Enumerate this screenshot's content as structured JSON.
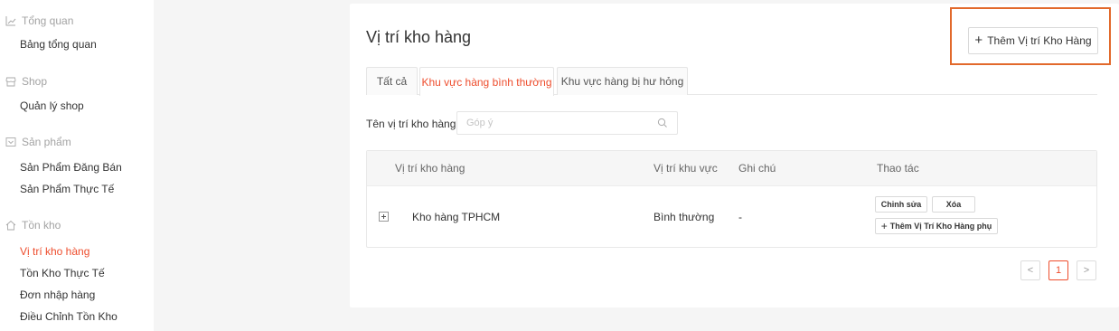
{
  "sidebar": {
    "groups": [
      {
        "label": "Tổng quan",
        "icon": "chart-line-icon",
        "items": [
          {
            "label": "Bảng tổng quan"
          }
        ]
      },
      {
        "label": "Shop",
        "icon": "shop-icon",
        "items": [
          {
            "label": "Quản lý shop"
          }
        ]
      },
      {
        "label": "Sản phẩm",
        "icon": "product-box-icon",
        "items": [
          {
            "label": "Sản Phẩm Đăng Bán"
          },
          {
            "label": "Sản Phẩm Thực Tế"
          }
        ]
      },
      {
        "label": "Tồn kho",
        "icon": "home-icon",
        "items": [
          {
            "label": "Vị trí kho hàng",
            "active": true
          },
          {
            "label": "Tồn Kho Thực Tế"
          },
          {
            "label": "Đơn nhập hàng"
          },
          {
            "label": "Điều Chỉnh Tồn Kho"
          }
        ]
      }
    ]
  },
  "main": {
    "title": "Vị trí kho hàng",
    "add_button": {
      "icon": "plus-icon",
      "label": "Thêm Vị trí Kho Hàng"
    },
    "tabs": [
      {
        "label": "Tất cả",
        "active": false
      },
      {
        "label": "Khu vực hàng bình thường",
        "active": true
      },
      {
        "label": "Khu vực hàng bị hư hỏng",
        "active": false
      }
    ],
    "filter": {
      "label": "Tên vị trí kho hàng",
      "placeholder": "Góp ý",
      "value": ""
    },
    "table": {
      "columns": [
        "Vị trí kho hàng",
        "Vị trí khu vực",
        "Ghi chú",
        "Thao tác"
      ],
      "rows": [
        {
          "name": "Kho hàng TPHCM",
          "area": "Bình thường",
          "note": "-",
          "actions": {
            "edit": "Chỉnh sửa",
            "delete": "Xóa",
            "add_sub": "Thêm Vị Trí Kho Hàng phụ"
          }
        }
      ]
    },
    "pagination": {
      "prev": "<",
      "current": "1",
      "next": ">"
    }
  },
  "colors": {
    "accent": "#ee4d2d",
    "highlight_border": "#e2692b"
  }
}
